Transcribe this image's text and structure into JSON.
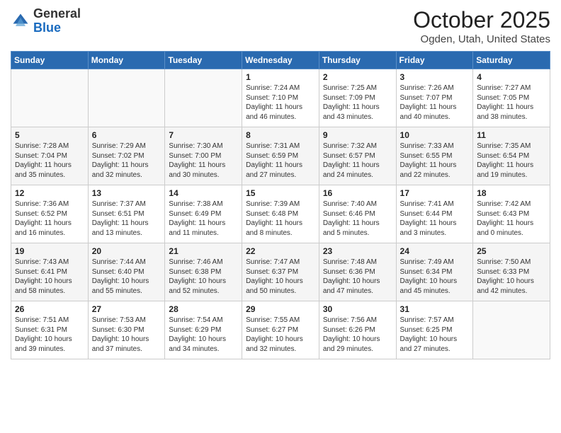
{
  "header": {
    "logo_general": "General",
    "logo_blue": "Blue",
    "month_title": "October 2025",
    "subtitle": "Ogden, Utah, United States"
  },
  "days_of_week": [
    "Sunday",
    "Monday",
    "Tuesday",
    "Wednesday",
    "Thursday",
    "Friday",
    "Saturday"
  ],
  "weeks": [
    [
      {
        "num": "",
        "sunrise": "",
        "sunset": "",
        "daylight": ""
      },
      {
        "num": "",
        "sunrise": "",
        "sunset": "",
        "daylight": ""
      },
      {
        "num": "",
        "sunrise": "",
        "sunset": "",
        "daylight": ""
      },
      {
        "num": "1",
        "sunrise": "Sunrise: 7:24 AM",
        "sunset": "Sunset: 7:10 PM",
        "daylight": "Daylight: 11 hours and 46 minutes."
      },
      {
        "num": "2",
        "sunrise": "Sunrise: 7:25 AM",
        "sunset": "Sunset: 7:09 PM",
        "daylight": "Daylight: 11 hours and 43 minutes."
      },
      {
        "num": "3",
        "sunrise": "Sunrise: 7:26 AM",
        "sunset": "Sunset: 7:07 PM",
        "daylight": "Daylight: 11 hours and 40 minutes."
      },
      {
        "num": "4",
        "sunrise": "Sunrise: 7:27 AM",
        "sunset": "Sunset: 7:05 PM",
        "daylight": "Daylight: 11 hours and 38 minutes."
      }
    ],
    [
      {
        "num": "5",
        "sunrise": "Sunrise: 7:28 AM",
        "sunset": "Sunset: 7:04 PM",
        "daylight": "Daylight: 11 hours and 35 minutes."
      },
      {
        "num": "6",
        "sunrise": "Sunrise: 7:29 AM",
        "sunset": "Sunset: 7:02 PM",
        "daylight": "Daylight: 11 hours and 32 minutes."
      },
      {
        "num": "7",
        "sunrise": "Sunrise: 7:30 AM",
        "sunset": "Sunset: 7:00 PM",
        "daylight": "Daylight: 11 hours and 30 minutes."
      },
      {
        "num": "8",
        "sunrise": "Sunrise: 7:31 AM",
        "sunset": "Sunset: 6:59 PM",
        "daylight": "Daylight: 11 hours and 27 minutes."
      },
      {
        "num": "9",
        "sunrise": "Sunrise: 7:32 AM",
        "sunset": "Sunset: 6:57 PM",
        "daylight": "Daylight: 11 hours and 24 minutes."
      },
      {
        "num": "10",
        "sunrise": "Sunrise: 7:33 AM",
        "sunset": "Sunset: 6:55 PM",
        "daylight": "Daylight: 11 hours and 22 minutes."
      },
      {
        "num": "11",
        "sunrise": "Sunrise: 7:35 AM",
        "sunset": "Sunset: 6:54 PM",
        "daylight": "Daylight: 11 hours and 19 minutes."
      }
    ],
    [
      {
        "num": "12",
        "sunrise": "Sunrise: 7:36 AM",
        "sunset": "Sunset: 6:52 PM",
        "daylight": "Daylight: 11 hours and 16 minutes."
      },
      {
        "num": "13",
        "sunrise": "Sunrise: 7:37 AM",
        "sunset": "Sunset: 6:51 PM",
        "daylight": "Daylight: 11 hours and 13 minutes."
      },
      {
        "num": "14",
        "sunrise": "Sunrise: 7:38 AM",
        "sunset": "Sunset: 6:49 PM",
        "daylight": "Daylight: 11 hours and 11 minutes."
      },
      {
        "num": "15",
        "sunrise": "Sunrise: 7:39 AM",
        "sunset": "Sunset: 6:48 PM",
        "daylight": "Daylight: 11 hours and 8 minutes."
      },
      {
        "num": "16",
        "sunrise": "Sunrise: 7:40 AM",
        "sunset": "Sunset: 6:46 PM",
        "daylight": "Daylight: 11 hours and 5 minutes."
      },
      {
        "num": "17",
        "sunrise": "Sunrise: 7:41 AM",
        "sunset": "Sunset: 6:44 PM",
        "daylight": "Daylight: 11 hours and 3 minutes."
      },
      {
        "num": "18",
        "sunrise": "Sunrise: 7:42 AM",
        "sunset": "Sunset: 6:43 PM",
        "daylight": "Daylight: 11 hours and 0 minutes."
      }
    ],
    [
      {
        "num": "19",
        "sunrise": "Sunrise: 7:43 AM",
        "sunset": "Sunset: 6:41 PM",
        "daylight": "Daylight: 10 hours and 58 minutes."
      },
      {
        "num": "20",
        "sunrise": "Sunrise: 7:44 AM",
        "sunset": "Sunset: 6:40 PM",
        "daylight": "Daylight: 10 hours and 55 minutes."
      },
      {
        "num": "21",
        "sunrise": "Sunrise: 7:46 AM",
        "sunset": "Sunset: 6:38 PM",
        "daylight": "Daylight: 10 hours and 52 minutes."
      },
      {
        "num": "22",
        "sunrise": "Sunrise: 7:47 AM",
        "sunset": "Sunset: 6:37 PM",
        "daylight": "Daylight: 10 hours and 50 minutes."
      },
      {
        "num": "23",
        "sunrise": "Sunrise: 7:48 AM",
        "sunset": "Sunset: 6:36 PM",
        "daylight": "Daylight: 10 hours and 47 minutes."
      },
      {
        "num": "24",
        "sunrise": "Sunrise: 7:49 AM",
        "sunset": "Sunset: 6:34 PM",
        "daylight": "Daylight: 10 hours and 45 minutes."
      },
      {
        "num": "25",
        "sunrise": "Sunrise: 7:50 AM",
        "sunset": "Sunset: 6:33 PM",
        "daylight": "Daylight: 10 hours and 42 minutes."
      }
    ],
    [
      {
        "num": "26",
        "sunrise": "Sunrise: 7:51 AM",
        "sunset": "Sunset: 6:31 PM",
        "daylight": "Daylight: 10 hours and 39 minutes."
      },
      {
        "num": "27",
        "sunrise": "Sunrise: 7:53 AM",
        "sunset": "Sunset: 6:30 PM",
        "daylight": "Daylight: 10 hours and 37 minutes."
      },
      {
        "num": "28",
        "sunrise": "Sunrise: 7:54 AM",
        "sunset": "Sunset: 6:29 PM",
        "daylight": "Daylight: 10 hours and 34 minutes."
      },
      {
        "num": "29",
        "sunrise": "Sunrise: 7:55 AM",
        "sunset": "Sunset: 6:27 PM",
        "daylight": "Daylight: 10 hours and 32 minutes."
      },
      {
        "num": "30",
        "sunrise": "Sunrise: 7:56 AM",
        "sunset": "Sunset: 6:26 PM",
        "daylight": "Daylight: 10 hours and 29 minutes."
      },
      {
        "num": "31",
        "sunrise": "Sunrise: 7:57 AM",
        "sunset": "Sunset: 6:25 PM",
        "daylight": "Daylight: 10 hours and 27 minutes."
      },
      {
        "num": "",
        "sunrise": "",
        "sunset": "",
        "daylight": ""
      }
    ]
  ]
}
